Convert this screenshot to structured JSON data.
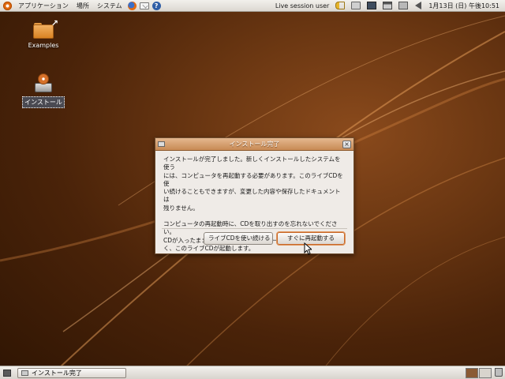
{
  "top_panel": {
    "menus": {
      "applications": "アプリケーション",
      "places": "場所",
      "system": "システム"
    },
    "launchers": [
      "firefox-icon",
      "mail-icon",
      "help-icon"
    ],
    "user": "Live session user",
    "clock": "1月13日 (日) 午後10:51",
    "tray_icons": [
      "key-icon",
      "printer-icon",
      "display-icon",
      "network-icon",
      "battery-icon",
      "volume-icon"
    ]
  },
  "desktop": {
    "icons": [
      {
        "label": "Examples",
        "icon": "folder-link-icon"
      },
      {
        "label": "インストール",
        "icon": "installer-icon",
        "selected": true
      }
    ]
  },
  "dialog": {
    "title": "インストール完了",
    "message_1": "インストールが完了しました。新しくインストールしたシステムを使う\nには、コンピュータを再起動する必要があります。このライブCDを使\nい続けることもできますが、変更した内容や保存したドキュメントは\n残りません。",
    "message_2": "コンピュータの再起動時に、CDを取り出すのを忘れないでください。\nCDが入ったままの場合、新しくインストールされたシステムではな\nく、このライブCDが起動します。",
    "buttons": {
      "continue": "ライブCDを使い続ける",
      "restart": "すぐに再起動する"
    },
    "close_glyph": "×"
  },
  "bottom_panel": {
    "task": "インストール完了",
    "workspaces": 2,
    "active_workspace": 1
  },
  "colors": {
    "accent": "#c8692a",
    "titlebar": "#d4a072",
    "desktop": "#5a2c0c"
  }
}
